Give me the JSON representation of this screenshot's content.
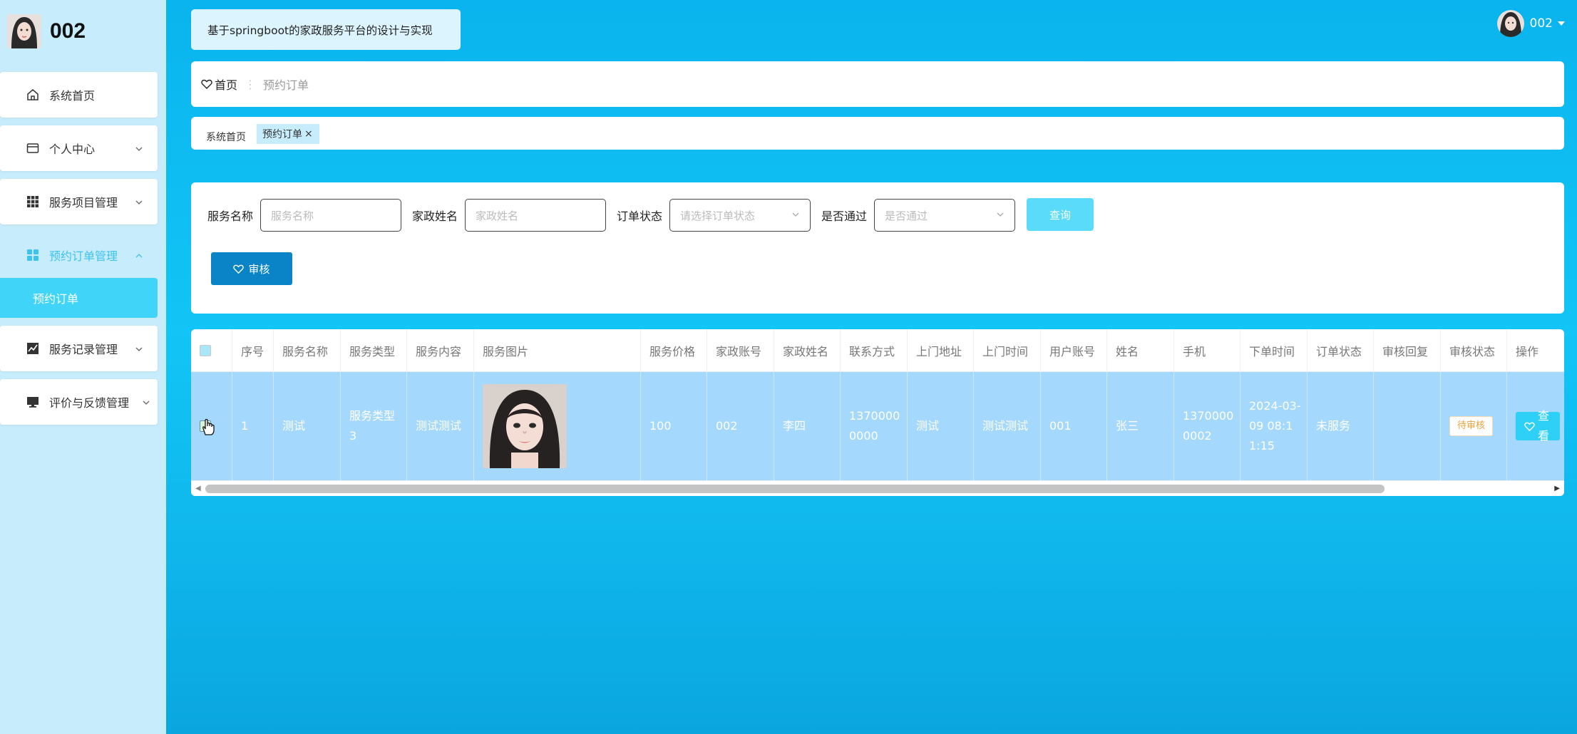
{
  "sidebar": {
    "username": "002",
    "menu": [
      {
        "label": "系统首页",
        "icon": "home-icon"
      },
      {
        "label": "个人中心",
        "icon": "card-icon"
      },
      {
        "label": "服务项目管理",
        "icon": "grid-icon"
      },
      {
        "label": "预约订单管理",
        "icon": "apps-icon"
      },
      {
        "label": "服务记录管理",
        "icon": "chart-icon"
      },
      {
        "label": "评价与反馈管理",
        "icon": "monitor-icon"
      }
    ],
    "submenu_active": "预约订单"
  },
  "header": {
    "site_title": "基于springboot的家政服务平台的设计与实现",
    "user_name": "002"
  },
  "breadcrumb": {
    "home": "首页",
    "current": "预约订单"
  },
  "tabs": {
    "home": "系统首页",
    "active": "预约订单",
    "close": "×"
  },
  "search": {
    "service_name_label": "服务名称",
    "service_name_placeholder": "服务名称",
    "staff_name_label": "家政姓名",
    "staff_name_placeholder": "家政姓名",
    "status_label": "订单状态",
    "status_placeholder": "请选择订单状态",
    "passed_label": "是否通过",
    "passed_placeholder": "是否通过",
    "query_button": "查询",
    "audit_button": "审核"
  },
  "table": {
    "headers": [
      "序号",
      "服务名称",
      "服务类型",
      "服务内容",
      "服务图片",
      "服务价格",
      "家政账号",
      "家政姓名",
      "联系方式",
      "上门地址",
      "上门时间",
      "用户账号",
      "姓名",
      "手机",
      "下单时间",
      "订单状态",
      "审核回复",
      "审核状态",
      "操作"
    ],
    "row": {
      "index": "1",
      "service_name": "测试",
      "service_type": "服务类型3",
      "service_content": "测试测试",
      "price": "100",
      "staff_account": "002",
      "staff_name": "李四",
      "contact": "13700000000",
      "address": "测试",
      "visit_time": "测试测试",
      "user_account": "001",
      "name": "张三",
      "phone": "13700000002",
      "order_time": "2024-03-09 08:11:15",
      "order_status": "未服务",
      "audit_reply": "",
      "audit_status": "待审核",
      "action": "查看"
    }
  },
  "colors": {
    "accent": "#3fd4f8",
    "sidebar": "#c7ecfb",
    "primary_button": "#0a84c6",
    "row_selected": "#a4d8fc"
  }
}
